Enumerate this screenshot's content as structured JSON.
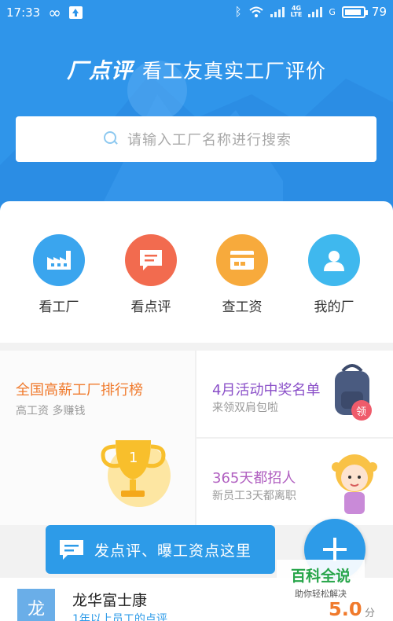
{
  "status_bar": {
    "time": "17:33",
    "battery": "79",
    "net_top": "4G",
    "net_bottom": "LTE",
    "sim": "G"
  },
  "brand": {
    "logo": "厂点评",
    "slogan": "看工友真实工厂评价"
  },
  "search": {
    "placeholder": "请输入工厂名称进行搜索"
  },
  "quick_nav": [
    {
      "label": "看工厂",
      "icon": "factory-icon",
      "color": "#3aa5ee"
    },
    {
      "label": "看点评",
      "icon": "comment-icon",
      "color": "#f26b4f"
    },
    {
      "label": "查工资",
      "icon": "salary-card-icon",
      "color": "#f7aa3c"
    },
    {
      "label": "我的厂",
      "icon": "user-icon",
      "color": "#3fb8ee"
    }
  ],
  "promos": {
    "ranking": {
      "title": "全国高薪工厂排行榜",
      "subtitle": "高工资 多赚钱"
    },
    "event": {
      "title": "4月活动中奖名单",
      "subtitle": "来领双肩包啦",
      "badge": "领"
    },
    "hiring": {
      "title": "365天都招人",
      "subtitle": "新员工3天都离职"
    }
  },
  "float_bar": {
    "label": "发点评、曝工资点这里"
  },
  "list_item": {
    "avatar": "龙",
    "name": "龙华富士康",
    "subtitle": "1年以上员工的点评",
    "score": "5.0",
    "unit": "分"
  },
  "watermark": {
    "title": "百科全说",
    "subtitle": "助你轻松解决"
  },
  "colors": {
    "primary": "#2f95ea",
    "ranking_title": "#f07a2c",
    "event_title": "#8a4fc8",
    "hiring_title": "#b05fc0",
    "score": "#f07a2c"
  }
}
